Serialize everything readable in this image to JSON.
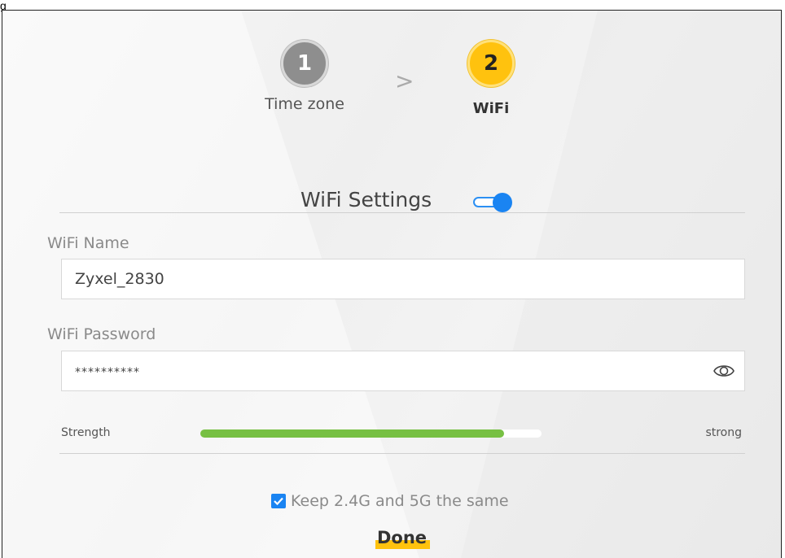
{
  "caption": "g",
  "wizard": {
    "steps": [
      {
        "number": "1",
        "label": "Time zone",
        "state": "completed"
      },
      {
        "number": "2",
        "label": "WiFi",
        "state": "active"
      }
    ],
    "separator": ">"
  },
  "wifi_settings": {
    "title": "WiFi Settings",
    "enabled": true,
    "name_label": "WiFi Name",
    "name_value": "Zyxel_2830",
    "password_label": "WiFi Password",
    "password_value": "**********",
    "strength_label": "Strength",
    "strength_value": "strong",
    "strength_fraction": 0.89,
    "keep_same_label": "Keep 2.4G and 5G the same",
    "keep_same_checked": true,
    "done_label": "Done"
  },
  "colors": {
    "accent_blue": "#1a84f2",
    "step_active": "#ffc20e",
    "step_completed": "#8e8e8e",
    "strength_fill": "#77c043"
  },
  "icons": {
    "toggle": "toggle-switch-icon",
    "eye": "eye-icon",
    "check": "checkmark-icon"
  }
}
